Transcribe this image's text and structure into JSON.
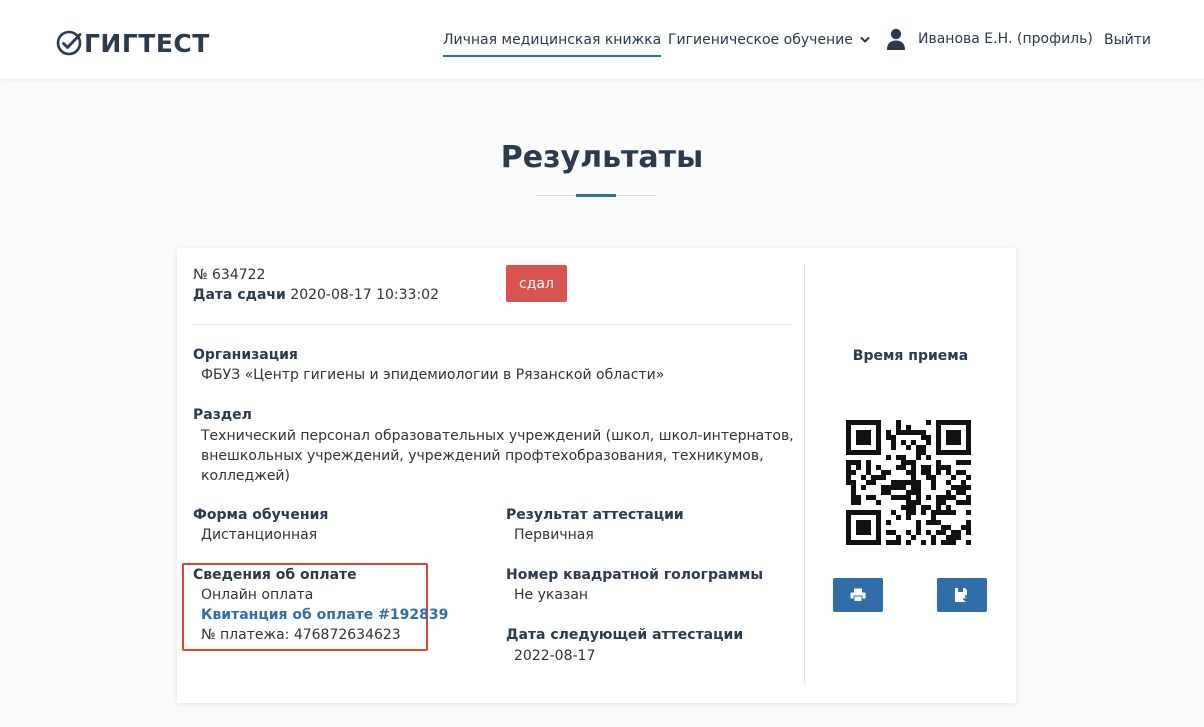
{
  "header": {
    "logo_text": "ГИГТЕСТ",
    "nav": {
      "medical_book": "Личная медицинская книжка",
      "hygiene_training": "Гигиеническое обучение",
      "user_profile": "Иванова Е.Н. (профиль)",
      "logout": "Выйти"
    }
  },
  "page": {
    "title": "Результаты"
  },
  "result": {
    "number_label": "№",
    "number_value": "634722",
    "date_label": "Дата сдачи",
    "date_value": "2020-08-17 10:33:02",
    "status": "сдал",
    "organization": {
      "label": "Организация",
      "value": "ФБУЗ «Центр гигиены и эпидемиологии в Рязанской области»"
    },
    "section": {
      "label": "Раздел",
      "lines": [
        "Технический персонал образовательных учреждений (школ, школ-интернатов,",
        "внешкольных учреждений, учреждений профтехобразования, техникумов,",
        "колледжей)"
      ]
    },
    "training_form": {
      "label": "Форма обучения",
      "value": "Дистанционная"
    },
    "attestation_result": {
      "label": "Результат аттестации",
      "value": "Первичная"
    },
    "payment": {
      "label": "Сведения об оплате",
      "method": "Онлайн оплата",
      "receipt_link": "Квитанция об оплате #192839",
      "payment_number_label": "№ платежа:",
      "payment_number_value": "476872634623"
    },
    "hologram": {
      "label": "Номер квадратной голограммы",
      "value": "Не указан"
    },
    "next_attestation": {
      "label": "Дата следующей аттестации",
      "value": "2022-08-17"
    }
  },
  "side": {
    "reception_time_label": "Время приема",
    "print_icon": "print-icon",
    "save_icon": "save-icon"
  },
  "colors": {
    "brand_dark": "#2b3a4c",
    "accent_blue": "#2f6ea8",
    "status_red": "#d9534f",
    "highlight_red": "#e0432e"
  }
}
